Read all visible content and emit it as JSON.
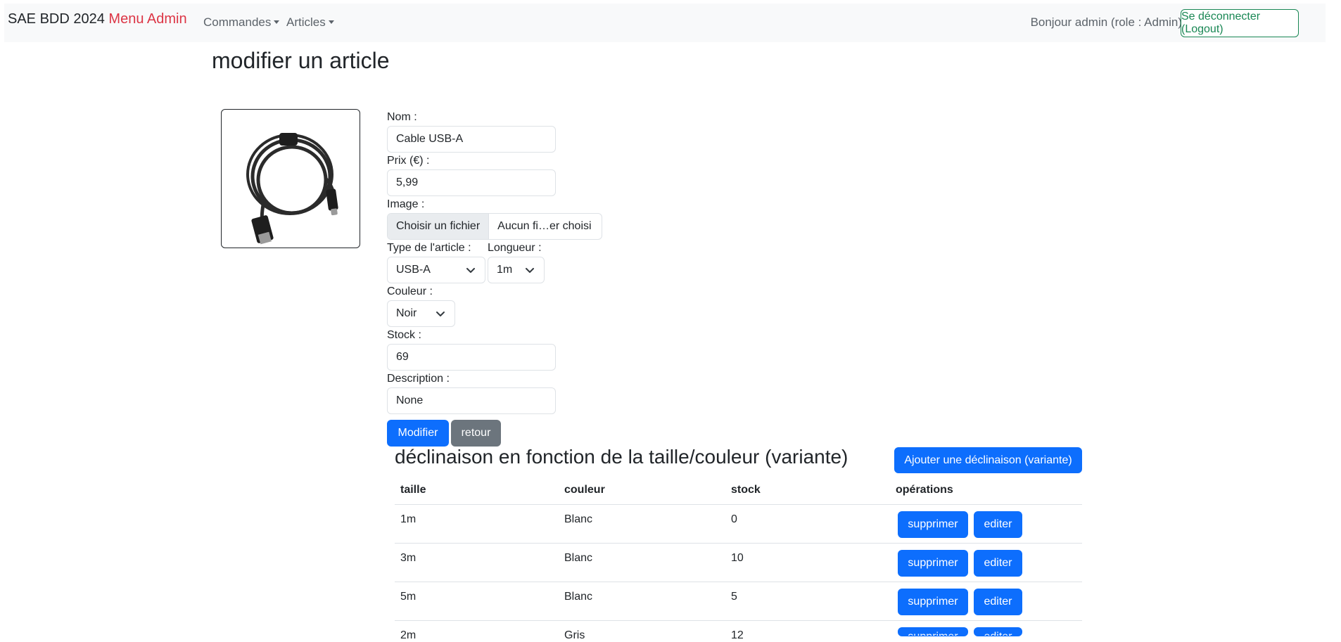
{
  "navbar": {
    "brand": "SAE BDD 2024",
    "brand_highlight": "Menu Admin",
    "menus": [
      "Commandes",
      "Articles"
    ],
    "greeting": "Bonjour admin (role : Admin)",
    "logout_label": "Se déconnecter (Logout)"
  },
  "page": {
    "title": "modifier un article"
  },
  "form": {
    "nom_label": "Nom :",
    "nom_value": "Cable USB-A",
    "prix_label": "Prix (€) :",
    "prix_value": "5,99",
    "image_label": "Image :",
    "file_button": "Choisir un fichier",
    "file_status": "Aucun fi…er choisi",
    "type_label": "Type de l'article :",
    "type_value": "USB-A",
    "longueur_label": "Longueur :",
    "longueur_value": "1m",
    "couleur_label": "Couleur :",
    "couleur_value": "Noir",
    "stock_label": "Stock :",
    "stock_value": "69",
    "description_label": "Description :",
    "description_value": "None",
    "submit_label": "Modifier",
    "back_label": "retour"
  },
  "variants": {
    "heading": "déclinaison en fonction de la taille/couleur (variante)",
    "add_label": "Ajouter une déclinaison (variante)",
    "columns": [
      "taille",
      "couleur",
      "stock",
      "opérations"
    ],
    "delete_label": "supprimer",
    "edit_label": "editer",
    "rows": [
      {
        "taille": "1m",
        "couleur": "Blanc",
        "stock": "0"
      },
      {
        "taille": "3m",
        "couleur": "Blanc",
        "stock": "10"
      },
      {
        "taille": "5m",
        "couleur": "Blanc",
        "stock": "5"
      },
      {
        "taille": "2m",
        "couleur": "Gris",
        "stock": "12"
      }
    ]
  },
  "icons": {
    "product_image": "usb-cable-image",
    "dropdown": "chevron-down-icon",
    "menu_caret": "caret-down-icon"
  },
  "colors": {
    "primary": "#0d6efd",
    "secondary": "#6c757d",
    "success": "#198754",
    "brand_red": "#dc3545",
    "navbar_bg": "#f8f9fa"
  }
}
